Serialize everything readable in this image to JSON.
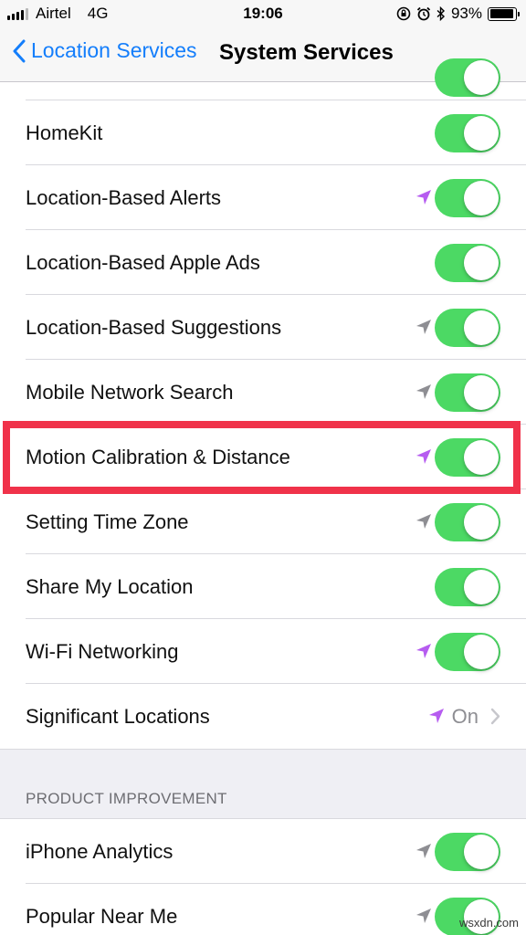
{
  "status_bar": {
    "carrier": "Airtel",
    "network": "4G",
    "time": "19:06",
    "battery_percent": "93%",
    "battery_level": 0.93,
    "icons": [
      "signal-icon",
      "rotation-lock-icon",
      "alarm-icon",
      "bluetooth-icon",
      "battery-icon"
    ]
  },
  "nav": {
    "back_label": "Location Services",
    "title": "System Services"
  },
  "rows": [
    {
      "label": "HomeKit",
      "toggle": true,
      "arrow": null
    },
    {
      "label": "Location-Based Alerts",
      "toggle": true,
      "arrow": "purple"
    },
    {
      "label": "Location-Based Apple Ads",
      "toggle": true,
      "arrow": null
    },
    {
      "label": "Location-Based Suggestions",
      "toggle": true,
      "arrow": "gray"
    },
    {
      "label": "Mobile Network Search",
      "toggle": true,
      "arrow": "gray"
    },
    {
      "label": "Motion Calibration & Distance",
      "toggle": true,
      "arrow": "purple",
      "highlighted": true
    },
    {
      "label": "Setting Time Zone",
      "toggle": true,
      "arrow": "gray"
    },
    {
      "label": "Share My Location",
      "toggle": true,
      "arrow": null
    },
    {
      "label": "Wi-Fi Networking",
      "toggle": true,
      "arrow": "purple"
    },
    {
      "label": "Significant Locations",
      "value": "On",
      "arrow": "purple"
    }
  ],
  "section": {
    "header": "PRODUCT IMPROVEMENT"
  },
  "rows2": [
    {
      "label": "iPhone Analytics",
      "toggle": true,
      "arrow": "gray"
    },
    {
      "label": "Popular Near Me",
      "toggle": true,
      "arrow": "gray"
    }
  ],
  "watermark": "wsxdn.com",
  "colors": {
    "toggle_on": "#4cd964",
    "tint": "#147efb",
    "arrow_purple": "#b65cf0",
    "arrow_gray": "#8e8e93",
    "highlight": "#f0324a"
  }
}
